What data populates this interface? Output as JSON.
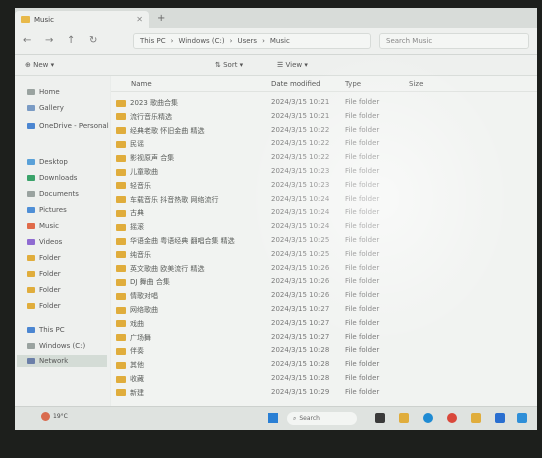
{
  "window": {
    "tab_title": "Music",
    "new_tab": "+"
  },
  "address_bar": {
    "back": "←",
    "forward": "→",
    "up": "↑",
    "refresh": "↻",
    "crumbs": [
      "This PC",
      "Windows (C:)",
      "Users",
      "Music"
    ],
    "search_placeholder": "Search Music"
  },
  "toolbar": {
    "new_label": "New",
    "sort_label": "Sort",
    "view_label": "View"
  },
  "sidebar": {
    "items": [
      {
        "label": "Home",
        "icon": "home-icon",
        "color": "#9aa3a0"
      },
      {
        "label": "Gallery",
        "icon": "gallery-icon",
        "color": "#7a9bc4"
      },
      {
        "label": "OneDrive - Personal",
        "icon": "onedrive-icon",
        "color": "#4b86d1"
      },
      {
        "label": "Desktop",
        "icon": "desktop-icon",
        "color": "#5aa1d8"
      },
      {
        "label": "Downloads",
        "icon": "downloads-icon",
        "color": "#3aa36a"
      },
      {
        "label": "Documents",
        "icon": "documents-icon",
        "color": "#9aa3a0"
      },
      {
        "label": "Pictures",
        "icon": "pictures-icon",
        "color": "#4f8fd6"
      },
      {
        "label": "Music",
        "icon": "music-icon",
        "color": "#e06b4a"
      },
      {
        "label": "Videos",
        "icon": "videos-icon",
        "color": "#8f6bd1"
      },
      {
        "label": "Folder",
        "icon": "folder-icon",
        "color": "#e0ad3c"
      },
      {
        "label": "Folder",
        "icon": "folder-icon",
        "color": "#e0ad3c"
      },
      {
        "label": "Folder",
        "icon": "folder-icon",
        "color": "#e0ad3c"
      },
      {
        "label": "Folder",
        "icon": "folder-icon",
        "color": "#e0ad3c"
      },
      {
        "label": "This PC",
        "icon": "pc-icon",
        "color": "#4b86d1"
      },
      {
        "label": "Windows (C:)",
        "icon": "drive-icon",
        "color": "#9aa3a0"
      },
      {
        "label": "Network",
        "icon": "network-icon",
        "color": "#6b7fa8"
      }
    ]
  },
  "columns": {
    "name": "Name",
    "date": "Date modified",
    "type": "Type",
    "size": "Size"
  },
  "files": [
    {
      "name": "2023 歌曲合集",
      "date": "2024/3/15 10:21",
      "type": "File folder"
    },
    {
      "name": "流行音乐精选",
      "date": "2024/3/15 10:21",
      "type": "File folder"
    },
    {
      "name": "经典老歌 怀旧金曲 精选",
      "date": "2024/3/15 10:22",
      "type": "File folder"
    },
    {
      "name": "民谣",
      "date": "2024/3/15 10:22",
      "type": "File folder"
    },
    {
      "name": "影视原声 合集",
      "date": "2024/3/15 10:22",
      "type": "File folder"
    },
    {
      "name": "儿童歌曲",
      "date": "2024/3/15 10:23",
      "type": "File folder"
    },
    {
      "name": "轻音乐",
      "date": "2024/3/15 10:23",
      "type": "File folder"
    },
    {
      "name": "车载音乐 抖音热歌 网络流行",
      "date": "2024/3/15 10:24",
      "type": "File folder"
    },
    {
      "name": "古典",
      "date": "2024/3/15 10:24",
      "type": "File folder"
    },
    {
      "name": "摇滚",
      "date": "2024/3/15 10:24",
      "type": "File folder"
    },
    {
      "name": "华语金曲 粤语经典 翻唱合集 精选",
      "date": "2024/3/15 10:25",
      "type": "File folder"
    },
    {
      "name": "纯音乐",
      "date": "2024/3/15 10:25",
      "type": "File folder"
    },
    {
      "name": "英文歌曲 欧美流行 精选",
      "date": "2024/3/15 10:26",
      "type": "File folder"
    },
    {
      "name": "DJ 舞曲 合集",
      "date": "2024/3/15 10:26",
      "type": "File folder"
    },
    {
      "name": "情歌对唱",
      "date": "2024/3/15 10:26",
      "type": "File folder"
    },
    {
      "name": "网络歌曲",
      "date": "2024/3/15 10:27",
      "type": "File folder"
    },
    {
      "name": "戏曲",
      "date": "2024/3/15 10:27",
      "type": "File folder"
    },
    {
      "name": "广场舞",
      "date": "2024/3/15 10:27",
      "type": "File folder"
    },
    {
      "name": "伴奏",
      "date": "2024/3/15 10:28",
      "type": "File folder"
    },
    {
      "name": "其他",
      "date": "2024/3/15 10:28",
      "type": "File folder"
    },
    {
      "name": "收藏",
      "date": "2024/3/15 10:28",
      "type": "File folder"
    },
    {
      "name": "新建",
      "date": "2024/3/15 10:29",
      "type": "File folder"
    }
  ],
  "taskbar": {
    "search_placeholder": "Search",
    "weather_temp": "19°C",
    "icons": [
      {
        "name": "widgets-icon",
        "color": "#3a3a3a"
      },
      {
        "name": "explorer-icon",
        "color": "#e0ad3c"
      },
      {
        "name": "edge-icon",
        "color": "#1f8bd3"
      },
      {
        "name": "chrome-icon",
        "color": "#d9483b"
      },
      {
        "name": "folder-icon",
        "color": "#e0ad3c"
      },
      {
        "name": "store-icon",
        "color": "#2a6fd0"
      },
      {
        "name": "app-icon",
        "color": "#2f8fd8"
      }
    ]
  }
}
